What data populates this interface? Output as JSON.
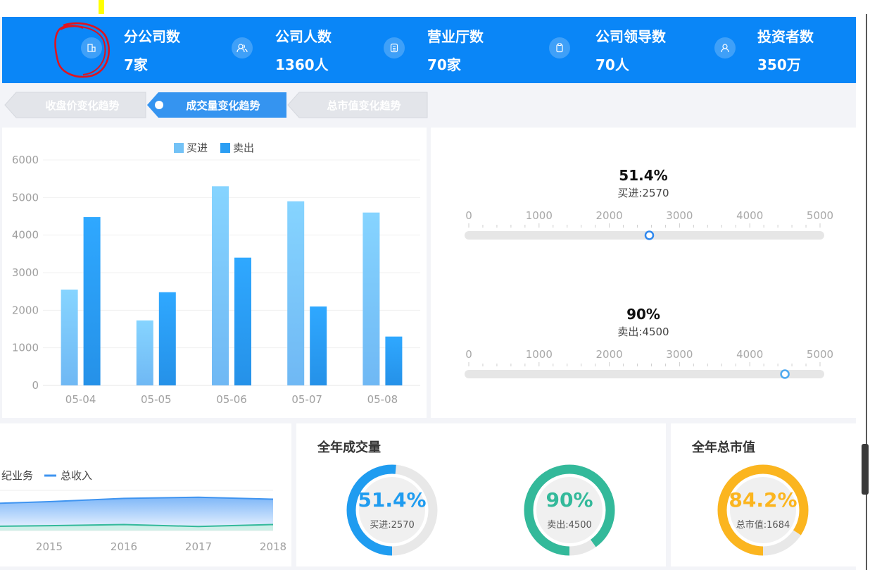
{
  "header": {
    "stats": [
      {
        "label": "分公司数",
        "value": "7家",
        "icon": "building-icon"
      },
      {
        "label": "公司人数",
        "value": "1360人",
        "icon": "users-icon"
      },
      {
        "label": "营业厅数",
        "value": "70家",
        "icon": "document-icon"
      },
      {
        "label": "公司领导数",
        "value": "70人",
        "icon": "clipboard-icon"
      },
      {
        "label": "投资者数",
        "value": "350万",
        "icon": "investor-icon"
      }
    ]
  },
  "tabs": [
    {
      "label": "收盘价变化趋势",
      "active": false
    },
    {
      "label": "成交量变化趋势",
      "active": true
    },
    {
      "label": "总市值变化趋势",
      "active": false
    }
  ],
  "colors": {
    "primary": "#0a86f7",
    "buy": "#71bcf6",
    "sell": "#2b9ef3",
    "green": "#33b99a",
    "orange": "#fbb51f"
  },
  "chart_data": [
    {
      "type": "bar",
      "categories": [
        "05-04",
        "05-05",
        "05-06",
        "05-07",
        "05-08"
      ],
      "series": [
        {
          "name": "买进",
          "values": [
            2550,
            1730,
            5300,
            4900,
            4600
          ]
        },
        {
          "name": "卖出",
          "values": [
            4480,
            2480,
            3400,
            2100,
            1300
          ]
        }
      ],
      "ylim": [
        0,
        6000
      ],
      "yticks": [
        0,
        1000,
        2000,
        3000,
        4000,
        5000,
        6000
      ],
      "legend": "top-center",
      "grid": true
    },
    {
      "type": "gauge",
      "items": [
        {
          "percent": "51.4%",
          "label": "买进:2570",
          "value": 2570,
          "max": 5000
        },
        {
          "percent": "90%",
          "label": "卖出:4500",
          "value": 4500,
          "max": 5000
        }
      ],
      "ticks": [
        "0",
        "1000",
        "2000",
        "3000",
        "4000",
        "5000"
      ]
    },
    {
      "type": "area",
      "x": [
        "2015",
        "2016",
        "2017",
        "2018"
      ],
      "legend_items": [
        "纪业务",
        "总收入"
      ],
      "series_fraction_top": [
        0.72,
        0.8,
        0.83,
        0.78
      ],
      "series_fraction_bottom": [
        0.12,
        0.15,
        0.1,
        0.15
      ]
    }
  ],
  "year_volume": {
    "title": "全年成交量",
    "rings": [
      {
        "percent": "51.4%",
        "sub": "买进:2570",
        "fraction": 0.514,
        "color": "#1f9cf0"
      },
      {
        "percent": "90%",
        "sub": "卖出:4500",
        "fraction": 0.9,
        "color": "#33b99a"
      }
    ]
  },
  "year_market": {
    "title": "全年总市值",
    "ring": {
      "percent": "84.2%",
      "sub": "总市值:1684",
      "fraction": 0.842,
      "color": "#fbb51f"
    }
  }
}
